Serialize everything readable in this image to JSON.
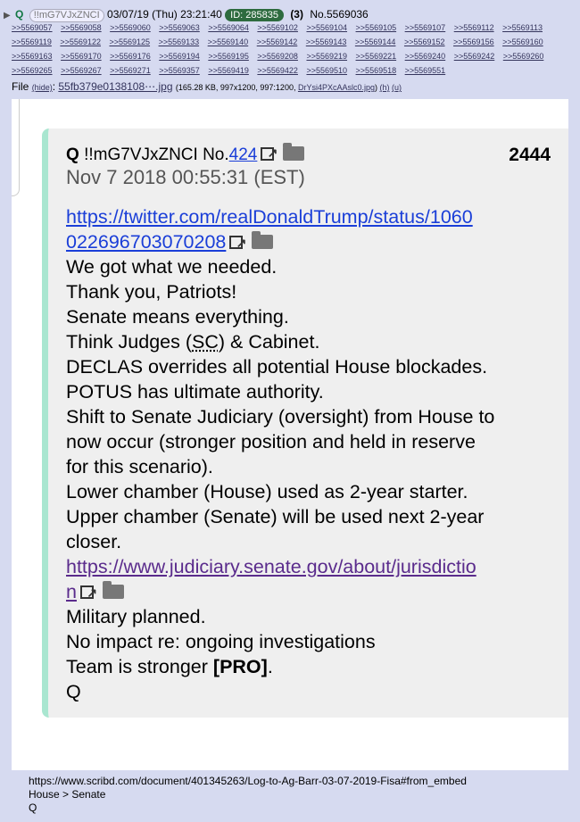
{
  "header": {
    "toggle": "▶",
    "name": "Q",
    "tripcode": "!!mG7VJxZNCI",
    "datetime": "03/07/19 (Thu) 23:21:40",
    "id_badge": "ID: 285835",
    "reply_count": "(3)",
    "post_no": "No.5569036"
  },
  "backlinks": [
    ">>5569057",
    ">>5569058",
    ">>5569060",
    ">>5569063",
    ">>5569064",
    ">>5569102",
    ">>5569104",
    ">>5569105",
    ">>5569107",
    ">>5569112",
    ">>5569113",
    ">>5569119",
    ">>5569122",
    ">>5569125",
    ">>5569133",
    ">>5569140",
    ">>5569142",
    ">>5569143",
    ">>5569144",
    ">>5569152",
    ">>5569156",
    ">>5569160",
    ">>5569163",
    ">>5569170",
    ">>5569176",
    ">>5569194",
    ">>5569195",
    ">>5569208",
    ">>5569219",
    ">>5569221",
    ">>5569240",
    ">>5569242",
    ">>5569260",
    ">>5569265",
    ">>5569267",
    ">>5569271",
    ">>5569357",
    ">>5569419",
    ">>5569422",
    ">>5569510",
    ">>5569518",
    ">>5569551"
  ],
  "file": {
    "label": "File",
    "hide": "(hide)",
    "name": "55fb379e0138108⋯.jpg",
    "meta": "(165.28 KB, 997x1200, 997:1200,",
    "orig": "DrYsi4PXcAAslc0.jpg",
    "h": "(h)",
    "u": "(u)",
    "close": ")"
  },
  "card": {
    "author": "Q",
    "trip": "!!mG7VJxZNCI",
    "no_label": "No.",
    "no_value": "424",
    "number": "2444",
    "date": "Nov 7 2018 00:55:31 (EST)",
    "link1_a": "https://twitter.com/realDonaldTrump/status/1060",
    "link1_b": "022696703070208",
    "l1": "We got what we needed.",
    "l2": "Thank you, Patriots!",
    "l3": "Senate means everything.",
    "l4_a": "Think Judges (",
    "l4_sc": "SC",
    "l4_b": ") & Cabinet.",
    "l5": "DECLAS overrides all potential House blockades.",
    "l6": "POTUS has ultimate authority.",
    "l7": "Shift to Senate Judiciary (oversight) from House to",
    "l8": "now occur (stronger position and held in reserve",
    "l9": "for this scenario).",
    "l10": "Lower chamber (House) used as 2-year starter.",
    "l11": "Upper chamber (Senate) will be used next 2-year",
    "l12": "closer.",
    "link2_a": "https://www.judiciary.senate.gov/about/jurisdictio",
    "link2_b": "n",
    "l13": "Military planned.",
    "l14": "No impact re: ongoing investigations",
    "l15_a": "Team is stronger ",
    "l15_b": "[PRO]",
    "l15_c": ".",
    "l16": "Q"
  },
  "footer": {
    "url": "https://www.scribd.com/document/401345263/Log-to-Ag-Barr-03-07-2019-Fisa#from_embed",
    "line2": "House > Senate",
    "line3": "Q"
  }
}
